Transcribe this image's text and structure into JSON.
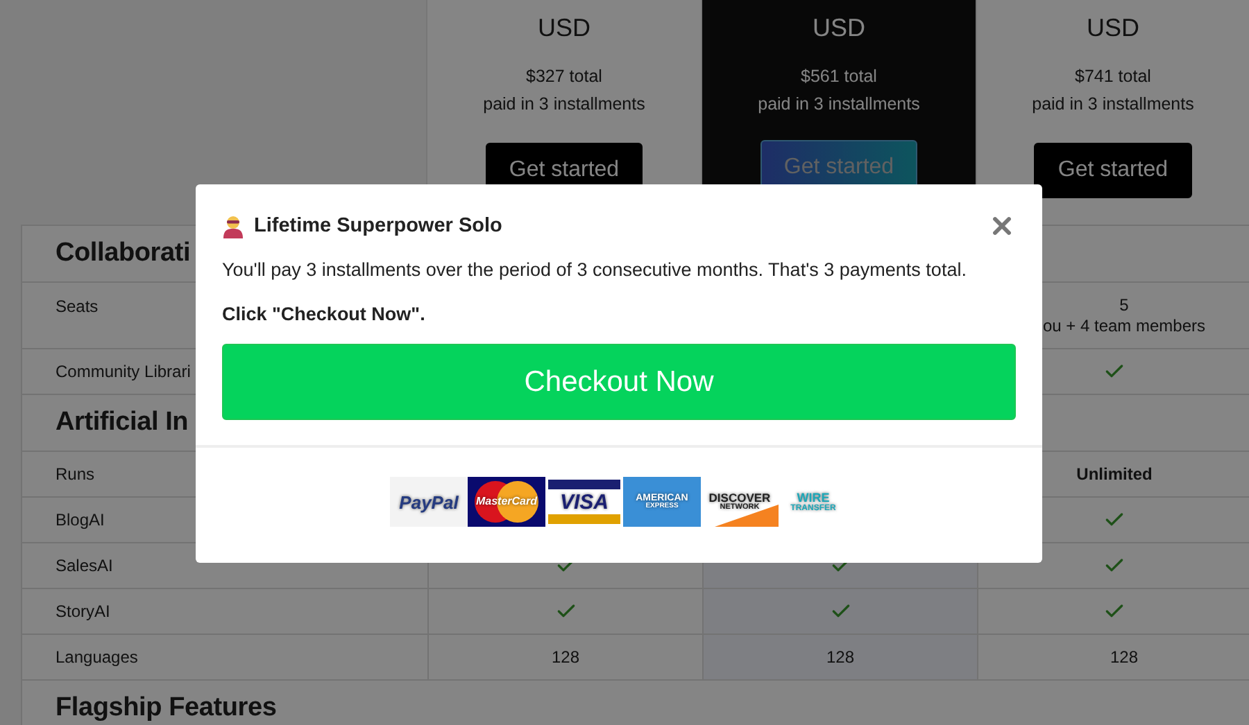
{
  "plans": [
    {
      "currency": "USD",
      "total": "$327 total",
      "note": "paid in 3 installments",
      "button": "Get started",
      "highlighted": false
    },
    {
      "currency": "USD",
      "total": "$561 total",
      "note": "paid in 3 installments",
      "button": "Get started",
      "highlighted": true
    },
    {
      "currency": "USD",
      "total": "$741 total",
      "note": "paid in 3 installments",
      "button": "Get started",
      "highlighted": false
    }
  ],
  "sections": [
    {
      "heading": "Collaborati",
      "rows": [
        {
          "label": "Seats",
          "column_3": {
            "kind": "text",
            "lines": [
              "5",
              "ou + 4 team members"
            ]
          }
        },
        {
          "label": "Community Librari",
          "column_3": {
            "kind": "check"
          }
        }
      ]
    },
    {
      "heading": "Artificial In",
      "rows": [
        {
          "label": "Runs",
          "column_3": {
            "kind": "bold",
            "lines": [
              "Unlimited"
            ]
          }
        },
        {
          "label": "BlogAI",
          "column_3": {
            "kind": "check"
          }
        },
        {
          "label": "SalesAI",
          "column_1": {
            "kind": "check"
          },
          "column_2": {
            "kind": "check"
          },
          "column_3": {
            "kind": "check"
          }
        },
        {
          "label": "StoryAI",
          "column_1": {
            "kind": "check"
          },
          "column_2": {
            "kind": "check"
          },
          "column_3": {
            "kind": "check"
          }
        },
        {
          "label": "Languages",
          "column_1": {
            "kind": "text",
            "lines": [
              "128"
            ]
          },
          "column_2": {
            "kind": "text",
            "lines": [
              "128"
            ]
          },
          "column_3": {
            "kind": "text",
            "lines": [
              "128"
            ]
          }
        }
      ]
    },
    {
      "heading": "Flagship Features"
    }
  ],
  "modal": {
    "title": "Lifetime Superpower Solo",
    "message": "You'll pay 3 installments over the period of 3 consecutive months. That's 3 payments total.",
    "instruction": "Click \"Checkout Now\".",
    "button": "Checkout Now",
    "payment_methods": [
      {
        "kind": "paypal",
        "lines": [
          "PayPal"
        ]
      },
      {
        "kind": "mastercard",
        "lines": [
          "MasterCard"
        ]
      },
      {
        "kind": "visa",
        "lines": [
          "VISA"
        ]
      },
      {
        "kind": "amex",
        "lines": [
          "AMERICAN",
          "EXPRESS"
        ]
      },
      {
        "kind": "discover",
        "lines": [
          "DISCOVER",
          "NETWORK"
        ]
      },
      {
        "kind": "wire",
        "lines": [
          "WIRE",
          "TRANSFER"
        ]
      }
    ]
  }
}
